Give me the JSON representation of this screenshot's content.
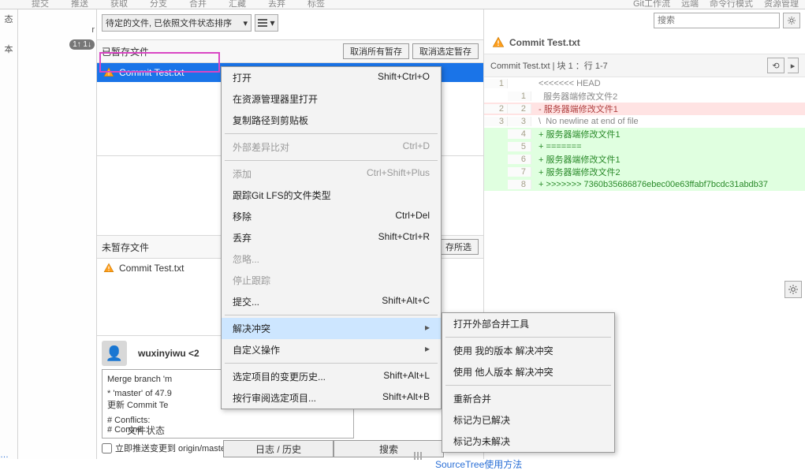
{
  "toolbar": {
    "items": [
      "提交",
      "推送",
      "获取",
      "分支",
      "合并",
      "汇藏",
      "丢弃",
      "标签"
    ],
    "right": [
      "Git工作流",
      "远端",
      "命令行模式",
      "资源管理"
    ]
  },
  "leftCol": {
    "a": "态",
    "b": "本"
  },
  "midCol": {
    "r": "r",
    "arrows": "1↑ 1↓"
  },
  "sort": {
    "label": "待定的文件, 已依照文件状态排序",
    "dd": "▾",
    "mini_dd": "▾"
  },
  "staged": {
    "header": "已暂存文件",
    "btn1": "取消所有暂存",
    "btn2": "取消选定暂存",
    "file": "Commit Test.txt"
  },
  "unstaged": {
    "header": "未暂存文件",
    "btn_partial": "存所选",
    "file": "Commit Test.txt"
  },
  "commit": {
    "user": "wuxinyiwu <2",
    "msg_l1": "Merge branch 'm",
    "msg_l2": "* 'master' of 47.9",
    "msg_l3": "更新 Commit Te",
    "msg_l4": "# Conflicts:",
    "msg_l5": "#        Commi",
    "push_cb": "立即推送变更到 origin/master",
    "file_status": "文件状态",
    "tab_log": "日志 / 历史",
    "tab_search": "搜索"
  },
  "ctx": {
    "open": "打开",
    "open_k": "Shift+Ctrl+O",
    "explorer": "在资源管理器里打开",
    "copypath": "复制路径到剪贴板",
    "extdiff": "外部差异比对",
    "extdiff_k": "Ctrl+D",
    "add": "添加",
    "add_k": "Ctrl+Shift+Plus",
    "lfs": "跟踪Git LFS的文件类型",
    "remove": "移除",
    "remove_k": "Ctrl+Del",
    "discard": "丢弃",
    "discard_k": "Shift+Ctrl+R",
    "ignore": "忽略...",
    "stoptrack": "停止跟踪",
    "commit": "提交...",
    "commit_k": "Shift+Alt+C",
    "resolve": "解决冲突",
    "arrow": "▸",
    "custom": "自定义操作",
    "loghist": "选定项目的变更历史...",
    "loghist_k": "Shift+Alt+L",
    "review": "按行审阅选定项目...",
    "review_k": "Shift+Alt+B"
  },
  "sub": {
    "ext_merge": "打开外部合并工具",
    "mine": "使用 我的版本 解决冲突",
    "theirs": "使用 他人版本 解决冲突",
    "remerge": "重新合并",
    "mark_resolved": "标记为已解决",
    "mark_unresolved": "标记为未解决"
  },
  "diff": {
    "search_ph": "搜索",
    "file_tab": "Commit Test.txt",
    "hunk": "Commit Test.txt  | 块 1 ：行 1-7",
    "btn_sq": "⟲",
    "lines": [
      {
        "o": "1",
        "n": "",
        "t": "ctx",
        "c": " <<<<<<< HEAD"
      },
      {
        "o": "",
        "n": "1",
        "t": "ctx",
        "c": "   服务器端修改文件2"
      },
      {
        "o": "2",
        "n": "2",
        "t": "del",
        "c": " - 服务器端修改文件1"
      },
      {
        "o": "3",
        "n": "3",
        "t": "info",
        "c": " \\  No newline at end of file"
      },
      {
        "o": "",
        "n": "4",
        "t": "add",
        "c": " + 服务器端修改文件1"
      },
      {
        "o": "",
        "n": "5",
        "t": "add",
        "c": " + ======="
      },
      {
        "o": "",
        "n": "6",
        "t": "add",
        "c": " + 服务器端修改文件1"
      },
      {
        "o": "",
        "n": "7",
        "t": "add",
        "c": " + 服务器端修改文件2"
      },
      {
        "o": "",
        "n": "8",
        "t": "add",
        "c": " + >>>>>>> 7360b35686876ebec00e63ffabf7bcdc31abdb37"
      }
    ]
  },
  "status_link": "SourceTree使用方法"
}
